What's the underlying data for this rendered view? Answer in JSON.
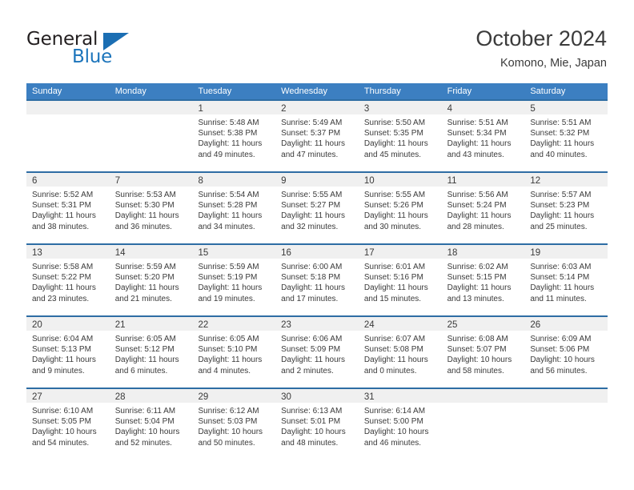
{
  "brand": {
    "name_part1": "General",
    "name_part2": "Blue",
    "triangle_color": "#1b6eb3",
    "text_color": "#231f20",
    "accent_color": "#1b74bb"
  },
  "header": {
    "title": "October 2024",
    "subtitle": "Komono, Mie, Japan"
  },
  "theme": {
    "header_row_bg": "#3c7fc1",
    "cell_top_border": "#2e6da4",
    "daynum_band_bg": "#f0f0f0",
    "text_color": "#3a3a3a"
  },
  "weekdays": [
    "Sunday",
    "Monday",
    "Tuesday",
    "Wednesday",
    "Thursday",
    "Friday",
    "Saturday"
  ],
  "weeks": [
    [
      {
        "day": "",
        "sunrise": "",
        "sunset": "",
        "daylight_line1": "",
        "daylight_line2": ""
      },
      {
        "day": "",
        "sunrise": "",
        "sunset": "",
        "daylight_line1": "",
        "daylight_line2": ""
      },
      {
        "day": "1",
        "sunrise": "Sunrise: 5:48 AM",
        "sunset": "Sunset: 5:38 PM",
        "daylight_line1": "Daylight: 11 hours",
        "daylight_line2": "and 49 minutes."
      },
      {
        "day": "2",
        "sunrise": "Sunrise: 5:49 AM",
        "sunset": "Sunset: 5:37 PM",
        "daylight_line1": "Daylight: 11 hours",
        "daylight_line2": "and 47 minutes."
      },
      {
        "day": "3",
        "sunrise": "Sunrise: 5:50 AM",
        "sunset": "Sunset: 5:35 PM",
        "daylight_line1": "Daylight: 11 hours",
        "daylight_line2": "and 45 minutes."
      },
      {
        "day": "4",
        "sunrise": "Sunrise: 5:51 AM",
        "sunset": "Sunset: 5:34 PM",
        "daylight_line1": "Daylight: 11 hours",
        "daylight_line2": "and 43 minutes."
      },
      {
        "day": "5",
        "sunrise": "Sunrise: 5:51 AM",
        "sunset": "Sunset: 5:32 PM",
        "daylight_line1": "Daylight: 11 hours",
        "daylight_line2": "and 40 minutes."
      }
    ],
    [
      {
        "day": "6",
        "sunrise": "Sunrise: 5:52 AM",
        "sunset": "Sunset: 5:31 PM",
        "daylight_line1": "Daylight: 11 hours",
        "daylight_line2": "and 38 minutes."
      },
      {
        "day": "7",
        "sunrise": "Sunrise: 5:53 AM",
        "sunset": "Sunset: 5:30 PM",
        "daylight_line1": "Daylight: 11 hours",
        "daylight_line2": "and 36 minutes."
      },
      {
        "day": "8",
        "sunrise": "Sunrise: 5:54 AM",
        "sunset": "Sunset: 5:28 PM",
        "daylight_line1": "Daylight: 11 hours",
        "daylight_line2": "and 34 minutes."
      },
      {
        "day": "9",
        "sunrise": "Sunrise: 5:55 AM",
        "sunset": "Sunset: 5:27 PM",
        "daylight_line1": "Daylight: 11 hours",
        "daylight_line2": "and 32 minutes."
      },
      {
        "day": "10",
        "sunrise": "Sunrise: 5:55 AM",
        "sunset": "Sunset: 5:26 PM",
        "daylight_line1": "Daylight: 11 hours",
        "daylight_line2": "and 30 minutes."
      },
      {
        "day": "11",
        "sunrise": "Sunrise: 5:56 AM",
        "sunset": "Sunset: 5:24 PM",
        "daylight_line1": "Daylight: 11 hours",
        "daylight_line2": "and 28 minutes."
      },
      {
        "day": "12",
        "sunrise": "Sunrise: 5:57 AM",
        "sunset": "Sunset: 5:23 PM",
        "daylight_line1": "Daylight: 11 hours",
        "daylight_line2": "and 25 minutes."
      }
    ],
    [
      {
        "day": "13",
        "sunrise": "Sunrise: 5:58 AM",
        "sunset": "Sunset: 5:22 PM",
        "daylight_line1": "Daylight: 11 hours",
        "daylight_line2": "and 23 minutes."
      },
      {
        "day": "14",
        "sunrise": "Sunrise: 5:59 AM",
        "sunset": "Sunset: 5:20 PM",
        "daylight_line1": "Daylight: 11 hours",
        "daylight_line2": "and 21 minutes."
      },
      {
        "day": "15",
        "sunrise": "Sunrise: 5:59 AM",
        "sunset": "Sunset: 5:19 PM",
        "daylight_line1": "Daylight: 11 hours",
        "daylight_line2": "and 19 minutes."
      },
      {
        "day": "16",
        "sunrise": "Sunrise: 6:00 AM",
        "sunset": "Sunset: 5:18 PM",
        "daylight_line1": "Daylight: 11 hours",
        "daylight_line2": "and 17 minutes."
      },
      {
        "day": "17",
        "sunrise": "Sunrise: 6:01 AM",
        "sunset": "Sunset: 5:16 PM",
        "daylight_line1": "Daylight: 11 hours",
        "daylight_line2": "and 15 minutes."
      },
      {
        "day": "18",
        "sunrise": "Sunrise: 6:02 AM",
        "sunset": "Sunset: 5:15 PM",
        "daylight_line1": "Daylight: 11 hours",
        "daylight_line2": "and 13 minutes."
      },
      {
        "day": "19",
        "sunrise": "Sunrise: 6:03 AM",
        "sunset": "Sunset: 5:14 PM",
        "daylight_line1": "Daylight: 11 hours",
        "daylight_line2": "and 11 minutes."
      }
    ],
    [
      {
        "day": "20",
        "sunrise": "Sunrise: 6:04 AM",
        "sunset": "Sunset: 5:13 PM",
        "daylight_line1": "Daylight: 11 hours",
        "daylight_line2": "and 9 minutes."
      },
      {
        "day": "21",
        "sunrise": "Sunrise: 6:05 AM",
        "sunset": "Sunset: 5:12 PM",
        "daylight_line1": "Daylight: 11 hours",
        "daylight_line2": "and 6 minutes."
      },
      {
        "day": "22",
        "sunrise": "Sunrise: 6:05 AM",
        "sunset": "Sunset: 5:10 PM",
        "daylight_line1": "Daylight: 11 hours",
        "daylight_line2": "and 4 minutes."
      },
      {
        "day": "23",
        "sunrise": "Sunrise: 6:06 AM",
        "sunset": "Sunset: 5:09 PM",
        "daylight_line1": "Daylight: 11 hours",
        "daylight_line2": "and 2 minutes."
      },
      {
        "day": "24",
        "sunrise": "Sunrise: 6:07 AM",
        "sunset": "Sunset: 5:08 PM",
        "daylight_line1": "Daylight: 11 hours",
        "daylight_line2": "and 0 minutes."
      },
      {
        "day": "25",
        "sunrise": "Sunrise: 6:08 AM",
        "sunset": "Sunset: 5:07 PM",
        "daylight_line1": "Daylight: 10 hours",
        "daylight_line2": "and 58 minutes."
      },
      {
        "day": "26",
        "sunrise": "Sunrise: 6:09 AM",
        "sunset": "Sunset: 5:06 PM",
        "daylight_line1": "Daylight: 10 hours",
        "daylight_line2": "and 56 minutes."
      }
    ],
    [
      {
        "day": "27",
        "sunrise": "Sunrise: 6:10 AM",
        "sunset": "Sunset: 5:05 PM",
        "daylight_line1": "Daylight: 10 hours",
        "daylight_line2": "and 54 minutes."
      },
      {
        "day": "28",
        "sunrise": "Sunrise: 6:11 AM",
        "sunset": "Sunset: 5:04 PM",
        "daylight_line1": "Daylight: 10 hours",
        "daylight_line2": "and 52 minutes."
      },
      {
        "day": "29",
        "sunrise": "Sunrise: 6:12 AM",
        "sunset": "Sunset: 5:03 PM",
        "daylight_line1": "Daylight: 10 hours",
        "daylight_line2": "and 50 minutes."
      },
      {
        "day": "30",
        "sunrise": "Sunrise: 6:13 AM",
        "sunset": "Sunset: 5:01 PM",
        "daylight_line1": "Daylight: 10 hours",
        "daylight_line2": "and 48 minutes."
      },
      {
        "day": "31",
        "sunrise": "Sunrise: 6:14 AM",
        "sunset": "Sunset: 5:00 PM",
        "daylight_line1": "Daylight: 10 hours",
        "daylight_line2": "and 46 minutes."
      },
      {
        "day": "",
        "sunrise": "",
        "sunset": "",
        "daylight_line1": "",
        "daylight_line2": ""
      },
      {
        "day": "",
        "sunrise": "",
        "sunset": "",
        "daylight_line1": "",
        "daylight_line2": ""
      }
    ]
  ]
}
